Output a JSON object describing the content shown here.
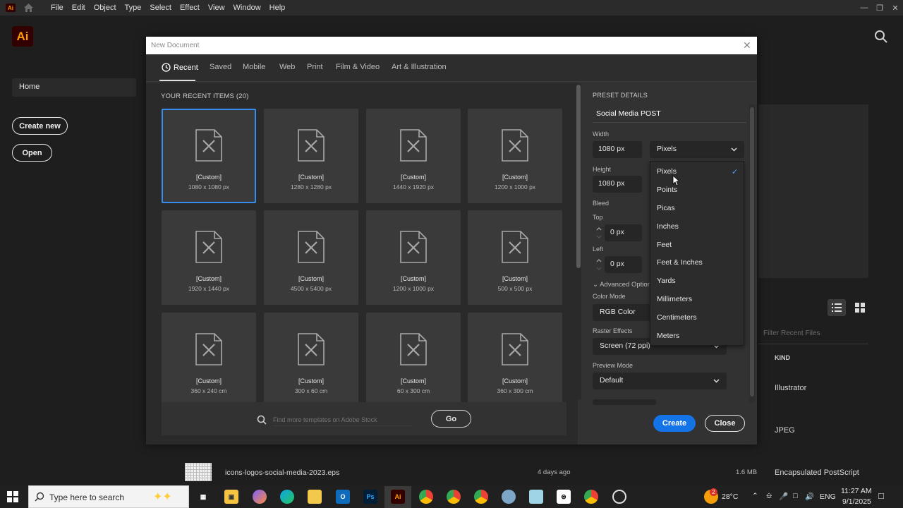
{
  "menubar": {
    "app_badge": "Ai",
    "items": [
      "File",
      "Edit",
      "Object",
      "Type",
      "Select",
      "Effect",
      "View",
      "Window",
      "Help"
    ]
  },
  "home": {
    "logo": "Ai",
    "nav_home": "Home",
    "create_new": "Create new",
    "open": "Open",
    "filter_placeholder": "Filter Recent Files",
    "kind_header": "KIND",
    "kind_rows": [
      "Illustrator",
      "JPEG"
    ],
    "file_row": {
      "name": "icons-logos-social-media-2023.eps",
      "date": "4 days ago",
      "size": "1.6 MB",
      "kind": "Encapsulated PostScript"
    }
  },
  "dialog": {
    "title": "New Document",
    "tabs": [
      "Recent",
      "Saved",
      "Mobile",
      "Web",
      "Print",
      "Film & Video",
      "Art & Illustration"
    ],
    "active_tab": "Recent",
    "recent_header": "YOUR RECENT ITEMS  (20)",
    "cards": [
      {
        "title": "[Custom]",
        "size": "1080 x 1080 px",
        "selected": true
      },
      {
        "title": "[Custom]",
        "size": "1280 x 1280 px"
      },
      {
        "title": "[Custom]",
        "size": "1440 x 1920 px"
      },
      {
        "title": "[Custom]",
        "size": "1200 x 1000 px"
      },
      {
        "title": "[Custom]",
        "size": "1920 x 1440 px"
      },
      {
        "title": "[Custom]",
        "size": "4500 x 5400 px"
      },
      {
        "title": "[Custom]",
        "size": "1200 x 1000 px"
      },
      {
        "title": "[Custom]",
        "size": "500 x 500 px"
      },
      {
        "title": "[Custom]",
        "size": "360 x 240 cm"
      },
      {
        "title": "[Custom]",
        "size": "300 x 60 cm"
      },
      {
        "title": "[Custom]",
        "size": "60 x 300 cm"
      },
      {
        "title": "[Custom]",
        "size": "360 x 300 cm"
      }
    ],
    "stock_placeholder": "Find more templates on Adobe Stock",
    "go": "Go",
    "preset": {
      "header": "PRESET DETAILS",
      "name": "Social Media POST",
      "width_label": "Width",
      "width_value": "1080 px",
      "units_value": "Pixels",
      "height_label": "Height",
      "height_value": "1080 px",
      "bleed_label": "Bleed",
      "top_label": "Top",
      "top_value": "0 px",
      "left_label": "Left",
      "left_value": "0 px",
      "advanced": "Advanced Option",
      "color_mode_label": "Color Mode",
      "color_mode_value": "RGB Color",
      "raster_label": "Raster Effects",
      "raster_value": "Screen (72 ppi)",
      "preview_label": "Preview Mode",
      "preview_value": "Default"
    },
    "create": "Create",
    "close": "Close",
    "units_options": [
      "Pixels",
      "Points",
      "Picas",
      "Inches",
      "Feet",
      "Feet & Inches",
      "Yards",
      "Millimeters",
      "Centimeters",
      "Meters"
    ],
    "units_selected": "Pixels"
  },
  "taskbar": {
    "search_placeholder": "Type here to search",
    "weather": "28°C",
    "lang": "ENG",
    "time": "11:27 AM",
    "date": "9/1/2025",
    "notification_count": "2"
  },
  "colors": {
    "accent": "#1473e6",
    "selection_border": "#378ef0",
    "ai_orange": "#ff9a00",
    "ai_bg": "#330000"
  }
}
